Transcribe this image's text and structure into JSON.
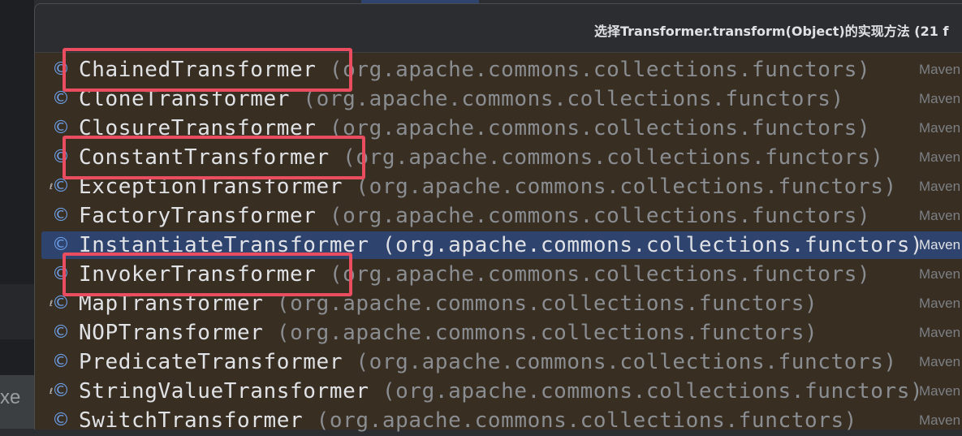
{
  "popup": {
    "title": "选择Transformer.transform(Object)的实现方法 (21 f"
  },
  "ide": {
    "side_text": "xe"
  },
  "icons": {
    "class": "class-icon",
    "class_glyph": "©",
    "modifier_glyph": "ℓ"
  },
  "colors": {
    "highlight_box": "#ea4d5f",
    "selection": "#2e436e",
    "list_background": "#382e22"
  },
  "items": [
    {
      "name": "ChainedTransformer",
      "package": "(org.apache.commons.collections.functors)",
      "source": "Maven",
      "modifier": false,
      "selected": false
    },
    {
      "name": "CloneTransformer",
      "package": "(org.apache.commons.collections.functors)",
      "source": "Maven",
      "modifier": false,
      "selected": false
    },
    {
      "name": "ClosureTransformer",
      "package": "(org.apache.commons.collections.functors)",
      "source": "Maven",
      "modifier": false,
      "selected": false
    },
    {
      "name": "ConstantTransformer",
      "package": "(org.apache.commons.collections.functors)",
      "source": "Maven",
      "modifier": false,
      "selected": false
    },
    {
      "name": "ExceptionTransformer",
      "package": "(org.apache.commons.collections.functors)",
      "source": "Maven",
      "modifier": true,
      "selected": false
    },
    {
      "name": "FactoryTransformer",
      "package": "(org.apache.commons.collections.functors)",
      "source": "Maven",
      "modifier": false,
      "selected": false
    },
    {
      "name": "InstantiateTransformer",
      "package": "(org.apache.commons.collections.functors)",
      "source": "Maven",
      "modifier": false,
      "selected": true
    },
    {
      "name": "InvokerTransformer",
      "package": "(org.apache.commons.collections.functors)",
      "source": "Maven",
      "modifier": false,
      "selected": false
    },
    {
      "name": "MapTransformer",
      "package": "(org.apache.commons.collections.functors)",
      "source": "Maven",
      "modifier": true,
      "selected": false
    },
    {
      "name": "NOPTransformer",
      "package": "(org.apache.commons.collections.functors)",
      "source": "Maven",
      "modifier": false,
      "selected": false
    },
    {
      "name": "PredicateTransformer",
      "package": "(org.apache.commons.collections.functors)",
      "source": "Maven",
      "modifier": false,
      "selected": false
    },
    {
      "name": "StringValueTransformer",
      "package": "(org.apache.commons.collections.functors)",
      "source": "Maven",
      "modifier": true,
      "selected": false
    },
    {
      "name": "SwitchTransformer",
      "package": "(org.apache.commons.collections.functors)",
      "source": "Maven",
      "modifier": false,
      "selected": false
    }
  ],
  "highlighted_items": [
    "ChainedTransformer",
    "ConstantTransformer",
    "InvokerTransformer"
  ]
}
